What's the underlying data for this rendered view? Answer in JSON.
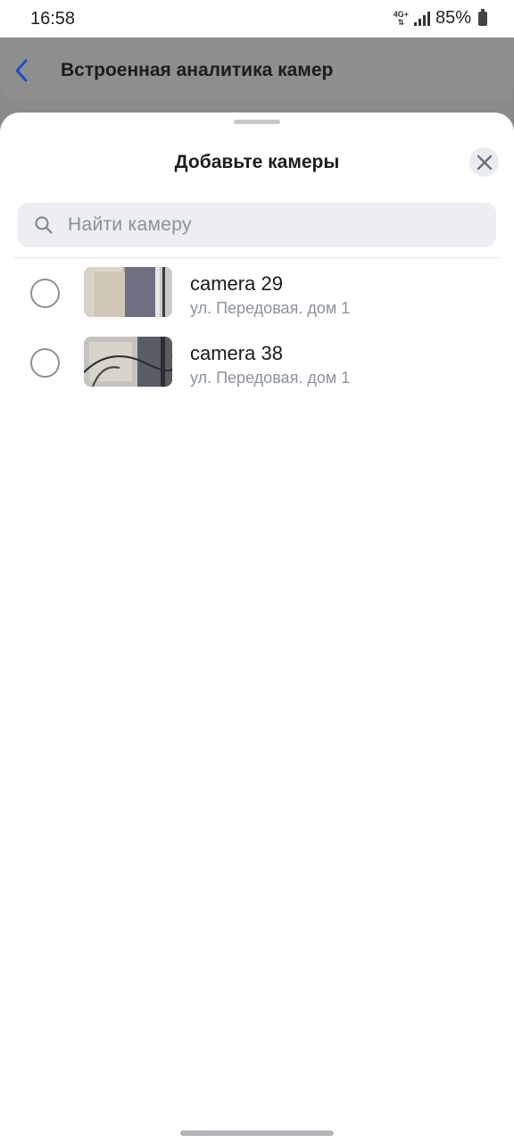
{
  "status": {
    "time": "16:58",
    "network": "4G+",
    "battery": "85%"
  },
  "header": {
    "title": "Встроенная аналитика камер",
    "back_icon": "chevron-left-icon"
  },
  "sheet": {
    "title": "Добавьте камеры",
    "close_icon": "close-icon",
    "search": {
      "placeholder": "Найти камеру",
      "value": ""
    },
    "cameras": [
      {
        "name": "camera 29",
        "address": "ул. Передовая. дом 1",
        "selected": false
      },
      {
        "name": "camera 38",
        "address": "ул. Передовая. дом 1",
        "selected": false
      }
    ]
  },
  "colors": {
    "accent": "#1f4fb8",
    "overlay": "#8a8a8c",
    "sheet": "#ffffff"
  }
}
